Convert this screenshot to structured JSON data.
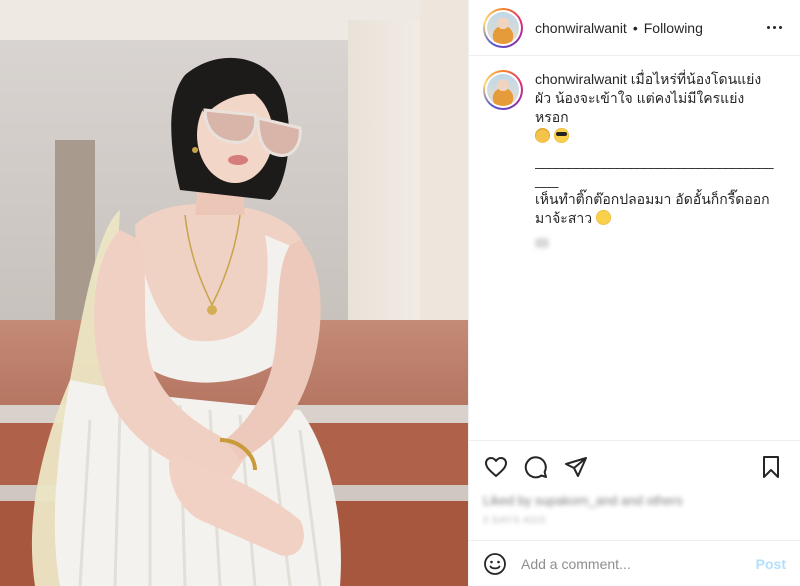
{
  "post": {
    "username": "chonwiralwanit",
    "separator": "•",
    "follow_status": "Following",
    "more_icon": "more-horizontal-icon"
  },
  "caption": {
    "username": "chonwiralwanit",
    "lines": [
      "เมื่อไหร่ที่น้องโดนแย่ง",
      "ผัว น้องจะเข้าใจ แต่คงไม่มีใครแย่งหรอก",
      "___________________________________",
      "___",
      "เห็นทำติ๊กต๊อกปลอมมา อัดอั้นก็กรี๊ดออก",
      "มาจ้ะสาว"
    ],
    "emojis": [
      "ok-hand-emoji",
      "cool-sunglasses-emoji",
      "wink-tongue-emoji"
    ]
  },
  "actions": {
    "like_icon": "heart-icon",
    "comment_icon": "comment-icon",
    "share_icon": "send-icon",
    "save_icon": "bookmark-icon",
    "likes_text": "Liked by supakorn_and and others",
    "timestamp": "3 DAYS AGO"
  },
  "comment_box": {
    "placeholder": "Add a comment...",
    "post_label": "Post",
    "emoji_icon": "smiley-icon"
  },
  "colors": {
    "text": "#262626",
    "secondary": "#8e8e8e",
    "post_button_disabled": "#b2dffc",
    "border": "#efefef"
  }
}
